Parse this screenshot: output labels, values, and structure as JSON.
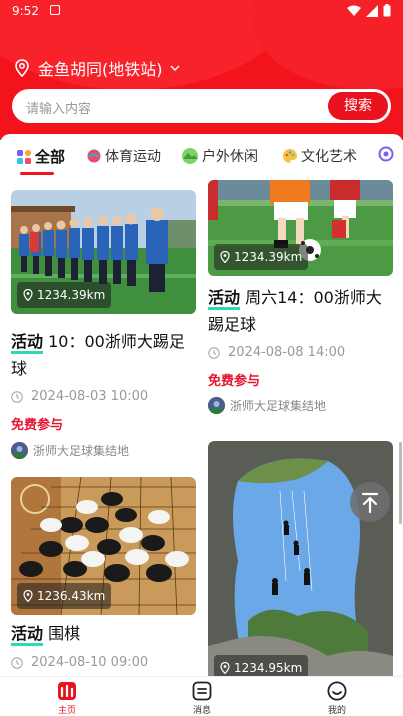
{
  "status_bar": {
    "time": "9:52"
  },
  "header": {
    "location": "金鱼胡同(地铁站)"
  },
  "search": {
    "placeholder": "请输入内容",
    "button": "搜索"
  },
  "tabs": [
    {
      "label": "全部"
    },
    {
      "label": "体育运动"
    },
    {
      "label": "户外休闲"
    },
    {
      "label": "文化艺术"
    }
  ],
  "cards": [
    {
      "distance": "1234.39km",
      "tag": "活动",
      "title": " 10：00浙师大踢足球",
      "date": "2024-08-03 10:00",
      "price": "免费参与",
      "venue": "浙师大足球集结地"
    },
    {
      "distance": "1234.39km",
      "tag": "活动",
      "title": " 周六14：00浙师大踢足球",
      "date": "2024-08-08 14:00",
      "price": "免费参与",
      "venue": "浙师大足球集结地"
    },
    {
      "distance": "1236.43km",
      "tag": "活动",
      "title": " 围棋",
      "date": "2024-08-10 09:00"
    },
    {
      "distance": "1234.95km"
    }
  ],
  "nav": [
    {
      "label": "主页"
    },
    {
      "label": "消息"
    },
    {
      "label": "我的"
    }
  ],
  "colors": {
    "brand": "#f2131d",
    "tag_underline": "#2fd7b5",
    "price": "#e8132e"
  }
}
